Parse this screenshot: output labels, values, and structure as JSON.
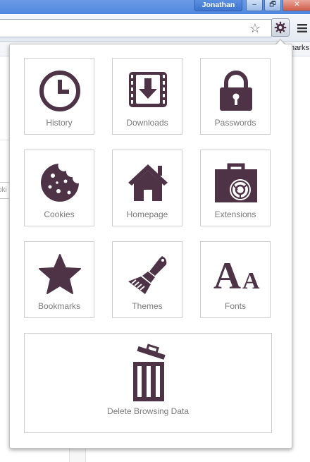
{
  "titlebar": {
    "user": "Jonathan",
    "minimize": "–",
    "restore": "🗗",
    "close": "✕"
  },
  "toolbar": {
    "star_icon": "☆",
    "bookmarks_partial": "marks"
  },
  "page_bg": {
    "input_partial": "oki"
  },
  "panel": {
    "tiles": [
      {
        "label": "History",
        "icon": "clock-icon"
      },
      {
        "label": "Downloads",
        "icon": "download-icon"
      },
      {
        "label": "Passwords",
        "icon": "lock-icon"
      },
      {
        "label": "Cookies",
        "icon": "cookie-icon"
      },
      {
        "label": "Homepage",
        "icon": "home-icon"
      },
      {
        "label": "Extensions",
        "icon": "extension-bag-icon"
      },
      {
        "label": "Bookmarks",
        "icon": "star-icon"
      },
      {
        "label": "Themes",
        "icon": "paintbrush-icon"
      },
      {
        "label": "Fonts",
        "icon": "fonts-icon",
        "glyphs": "AA"
      }
    ],
    "delete": {
      "label": "Delete Browsing Data",
      "icon": "trash-icon"
    }
  },
  "colors": {
    "icon": "#4e3346",
    "label": "#7a7a7a",
    "tile_border": "#cfcfcf",
    "titlebar": "#4f86df"
  }
}
